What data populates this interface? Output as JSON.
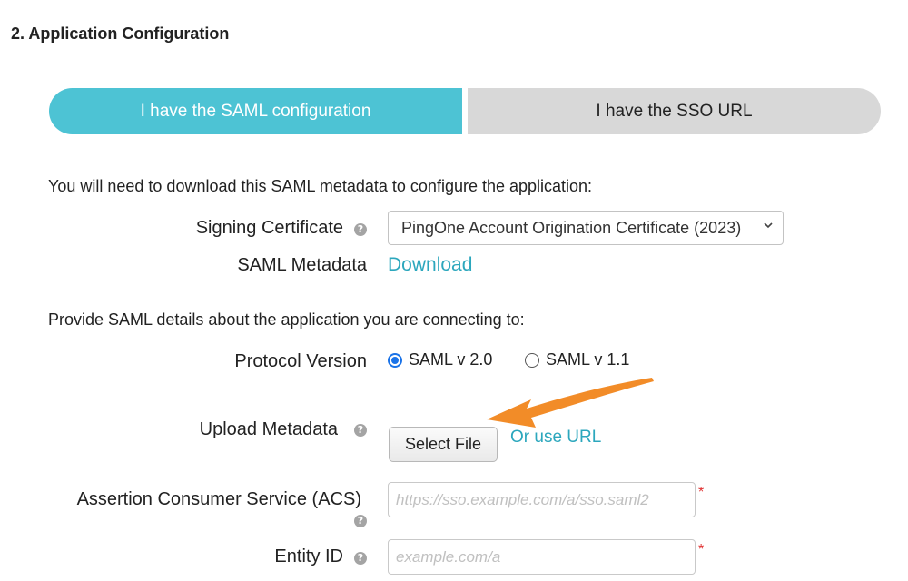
{
  "section": {
    "title": "2. Application Configuration"
  },
  "tabs": [
    {
      "label": "I have the SAML configuration",
      "active": true
    },
    {
      "label": "I have the SSO URL",
      "active": false
    }
  ],
  "download_section": {
    "intro": "You will need to download this SAML metadata to configure the application:",
    "signing_certificate": {
      "label": "Signing Certificate",
      "selected": "PingOne Account Origination Certificate (2023)"
    },
    "saml_metadata": {
      "label": "SAML Metadata",
      "link": "Download"
    }
  },
  "details_section": {
    "intro": "Provide SAML details about the application you are connecting to:",
    "protocol_version": {
      "label": "Protocol Version",
      "options": [
        {
          "label": "SAML v 2.0",
          "selected": true
        },
        {
          "label": "SAML v 1.1",
          "selected": false
        }
      ]
    },
    "upload_metadata": {
      "label": "Upload Metadata",
      "button": "Select File",
      "alt_link": "Or use URL"
    },
    "acs": {
      "label": "Assertion Consumer Service (ACS)",
      "value": "",
      "placeholder": "https://sso.example.com/a/sso.saml2",
      "required_mark": "*"
    },
    "entity_id": {
      "label": "Entity ID",
      "value": "",
      "placeholder": "example.com/a",
      "required_mark": "*"
    }
  },
  "icons": {
    "help": "?"
  },
  "colors": {
    "tab_active_bg": "#4dc3d4",
    "tab_inactive_bg": "#d8d8d8",
    "link": "#2ca7bd",
    "radio_selected": "#1a73e8",
    "required": "#e03030",
    "annotation_arrow": "#f28c28"
  }
}
